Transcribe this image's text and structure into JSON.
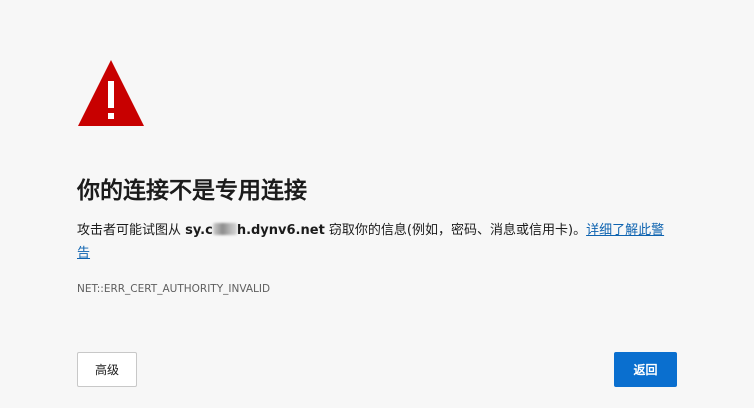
{
  "error": {
    "title": "你的连接不是专用连接",
    "message_prefix": "攻击者可能试图从 ",
    "host_start": "sy.c",
    "host_end": "h.dynv6.net",
    "message_suffix": " 窃取你的信息(例如，密码、消息或信用卡)。",
    "learn_more_link": "详细了解此警告",
    "error_code": "NET::ERR_CERT_AUTHORITY_INVALID"
  },
  "buttons": {
    "advanced_label": "高级",
    "back_label": "返回"
  },
  "colors": {
    "warning_red": "#c80000",
    "link_blue": "#0e63b0",
    "primary_button": "#0a6fcf",
    "background": "#f7f7f7"
  },
  "icons": {
    "warning": "warning-triangle-icon"
  }
}
